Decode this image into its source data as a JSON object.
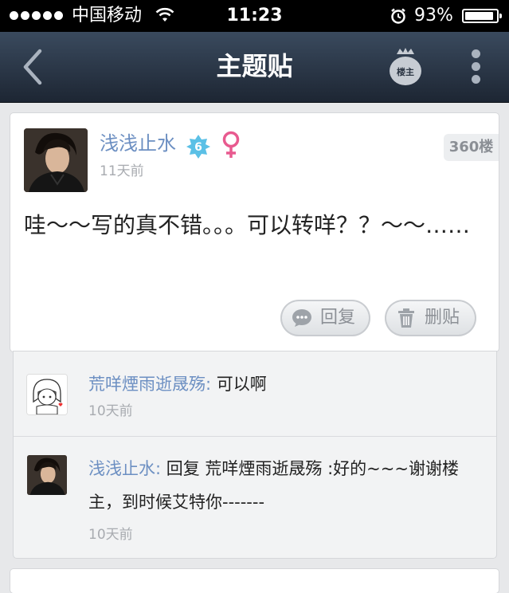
{
  "status_bar": {
    "carrier": "中国移动",
    "time": "11:23",
    "battery_percent": "93%",
    "battery_level": 0.93
  },
  "nav": {
    "title": "主题贴",
    "owner_label": "楼主"
  },
  "post": {
    "username": "浅浅止水",
    "level": "6",
    "gender": "female",
    "time": "11天前",
    "floor": "360楼",
    "content": "哇～～写的真不错。。。可以转咩？？～～……",
    "reply_label": "回复",
    "delete_label": "删贴"
  },
  "comments": [
    {
      "author": "荒咩煙雨逝晟殇:",
      "text": " 可以啊",
      "time": "10天前"
    },
    {
      "author": "浅浅止水:",
      "text": " 回复 荒咩煙雨逝晟殇 :好的~~~谢谢楼主，到时候艾特你-------",
      "time": "10天前"
    }
  ],
  "colors": {
    "link_blue": "#6c8fc2",
    "level_badge": "#5bc0e6",
    "female_pink": "#e85a8f"
  }
}
